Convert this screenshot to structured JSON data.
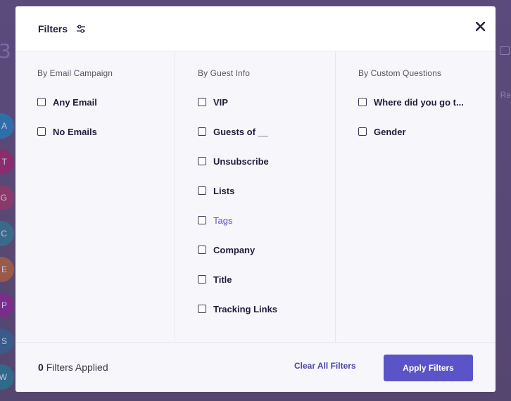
{
  "background": {
    "digit": "3",
    "right_text": "Re",
    "avatars": [
      {
        "letter": "A",
        "color": "#2f6fa8"
      },
      {
        "letter": "T",
        "color": "#8a2d6c"
      },
      {
        "letter": "G",
        "color": "#8a3a6a"
      },
      {
        "letter": "C",
        "color": "#3a6a8a"
      },
      {
        "letter": "E",
        "color": "#9a5a4a"
      },
      {
        "letter": "P",
        "color": "#7a2d8a"
      },
      {
        "letter": "S",
        "color": "#3a5a8a"
      },
      {
        "letter": "W",
        "color": "#2f6a8a"
      }
    ]
  },
  "modal": {
    "title": "Filters",
    "icons": {
      "title": "sliders-icon",
      "close": "close-icon"
    },
    "columns": [
      {
        "heading": "By Email Campaign",
        "options": [
          "Any Email",
          "No Emails"
        ]
      },
      {
        "heading": "By Guest Info",
        "options": [
          "VIP",
          "Guests of __",
          "Unsubscribe",
          "Lists",
          "Tags",
          "Company",
          "Title",
          "Tracking Links"
        ]
      },
      {
        "heading": "By Custom Questions",
        "options": [
          "Where did you go t...",
          "Gender"
        ]
      }
    ],
    "footer": {
      "count": "0",
      "applied_label": "Filters Applied",
      "clear_label": "Clear All Filters",
      "apply_label": "Apply Filters"
    }
  },
  "colors": {
    "accent": "#5a54c8",
    "link": "#4b43a8",
    "overlay": "#5a4a7a"
  }
}
